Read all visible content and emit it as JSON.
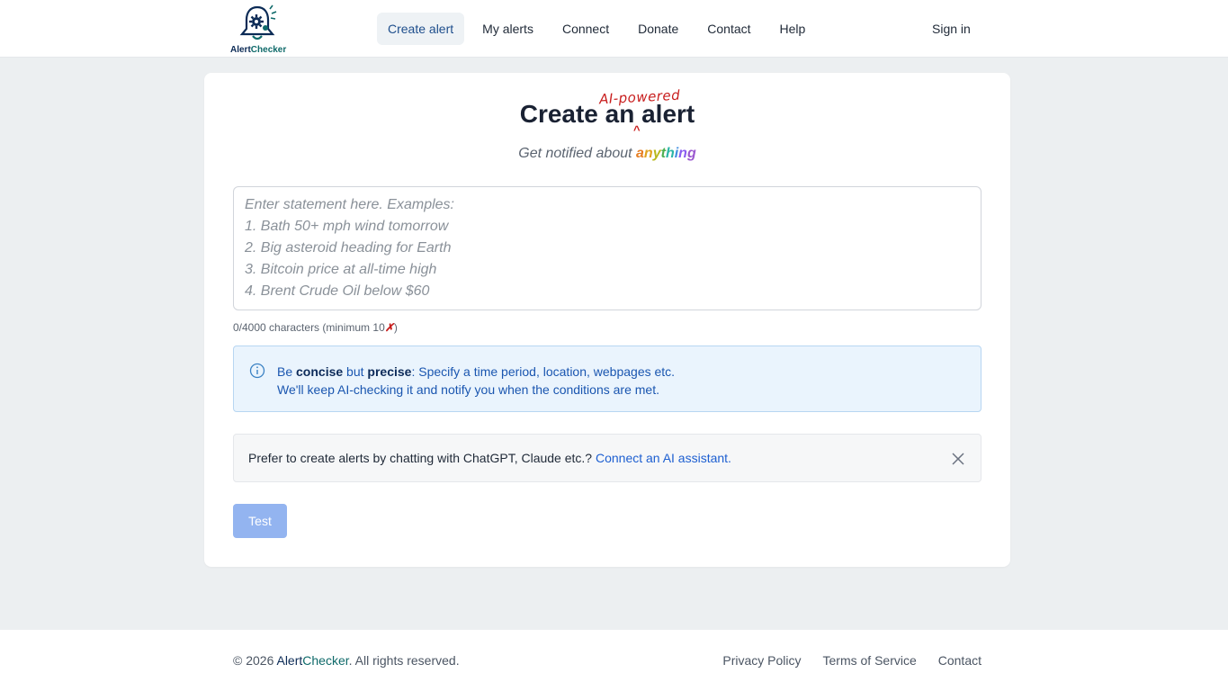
{
  "header": {
    "logo": {
      "brand_part1": "Alert",
      "brand_part2": "Checker"
    },
    "nav": [
      {
        "label": "Create alert",
        "active": true
      },
      {
        "label": "My alerts"
      },
      {
        "label": "Connect"
      },
      {
        "label": "Donate"
      },
      {
        "label": "Contact"
      },
      {
        "label": "Help"
      }
    ],
    "signin_label": "Sign in"
  },
  "main": {
    "title": "Create an alert",
    "title_annotation": "AI-powered",
    "caret": "^",
    "subtitle_prefix": "Get notified about",
    "subtitle_highlight": "anything",
    "statement": {
      "value": "",
      "placeholder": "Enter statement here. Examples:\n1. Bath 50+ mph wind tomorrow\n2. Big asteroid heading for Earth\n3. Bitcoin price at all-time high\n4. Brent Crude Oil below $60"
    },
    "char_count_text": "0/4000 characters (minimum 10",
    "char_count_mark": "✗",
    "char_count_close": ")",
    "info": {
      "be": "Be",
      "concise": "concise",
      "but": "but",
      "precise": "precise",
      "rest_line1": ": Specify a time period, location, webpages etc.",
      "line2": "We'll keep AI-checking it and notify you when the conditions are met."
    },
    "chat_banner": {
      "text": "Prefer to create alerts by chatting with ChatGPT, Claude etc.?",
      "link": "Connect an AI assistant."
    },
    "test_button": "Test"
  },
  "footer": {
    "copyright_prefix": "© 2026",
    "brand_part1": "Alert",
    "brand_part2": "Checker",
    "copyright_suffix": ". All rights reserved.",
    "links": [
      "Privacy Policy",
      "Terms of Service",
      "Contact"
    ]
  },
  "colors": {
    "primary": "#1d5fd1",
    "brand_navy": "#0c2b56",
    "brand_teal": "#0f6a6a",
    "annotation_red": "#c81e1e",
    "info_bg": "#eaf4fd"
  }
}
